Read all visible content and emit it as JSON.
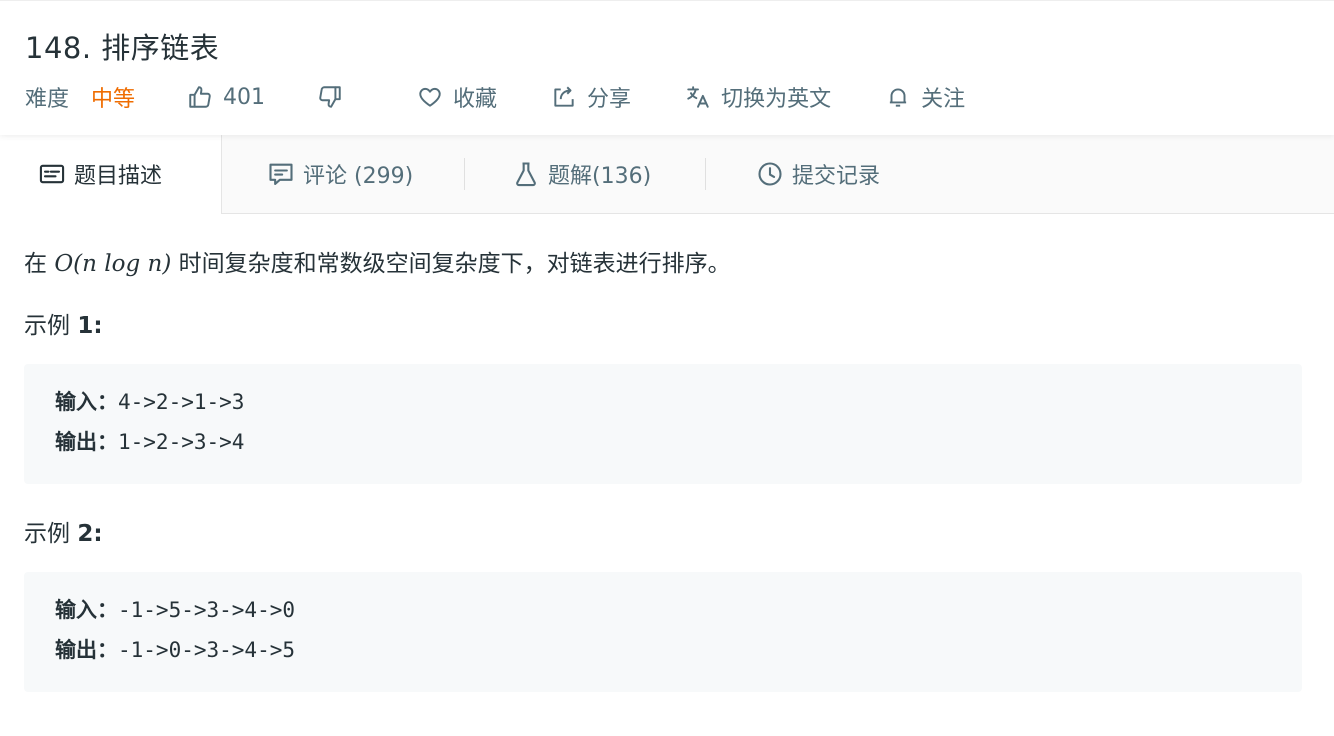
{
  "problem": {
    "title": "148. 排序链表",
    "difficulty_label": "难度",
    "difficulty_value": "中等"
  },
  "actions": {
    "like_count": "401",
    "favorite_label": "收藏",
    "share_label": "分享",
    "translate_label": "切换为英文",
    "follow_label": "关注"
  },
  "tabs": [
    {
      "label": "题目描述",
      "icon": "description-icon",
      "active": true
    },
    {
      "label": "评论 (299)",
      "icon": "comment-icon",
      "active": false
    },
    {
      "label": "题解(136)",
      "icon": "flask-icon",
      "active": false
    },
    {
      "label": "提交记录",
      "icon": "clock-icon",
      "active": false
    }
  ],
  "description": {
    "prefix": "在 ",
    "complexity_O": "O",
    "complexity_args": "(n log n)",
    "suffix": " 时间复杂度和常数级空间复杂度下，对链表进行排序。"
  },
  "examples": [
    {
      "title_prefix": "示例 ",
      "title_number": "1:",
      "input_label": "输入：",
      "input_value": "4->2->1->3",
      "output_label": "输出：",
      "output_value": "1->2->3->4"
    },
    {
      "title_prefix": "示例 ",
      "title_number": "2:",
      "input_label": "输入：",
      "input_value": "-1->5->3->4->0",
      "output_label": "输出：",
      "output_value": "-1->0->3->4->5"
    }
  ],
  "colors": {
    "difficulty_medium": "#ef6c00",
    "text_primary": "#263238",
    "text_secondary": "#546e7a",
    "code_background": "#f7f9fa"
  }
}
